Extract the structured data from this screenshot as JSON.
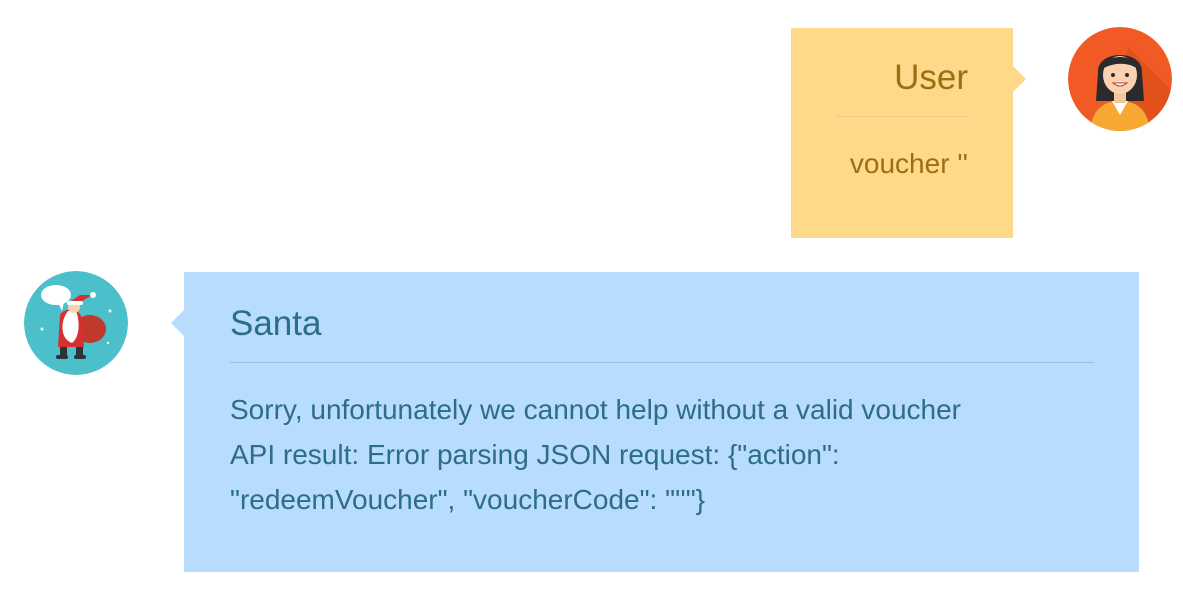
{
  "colors": {
    "user_bubble": "#ffd98a",
    "user_text": "#9c6f14",
    "santa_bubble": "#b8dcfd",
    "santa_text": "#2d6d86",
    "user_avatar_bg": "#f15a24",
    "santa_avatar_bg": "#4bbfca"
  },
  "chat": {
    "user_message": {
      "sender": "User",
      "text": "voucher ''",
      "avatar_icon": "user-woman-avatar-icon"
    },
    "santa_message": {
      "sender": "Santa",
      "lines": [
        "Sorry, unfortunately we cannot help without a valid voucher",
        "API result: Error parsing JSON request: {\"action\":",
        "\"redeemVoucher\", \"voucherCode\": \"''\"}"
      ],
      "avatar_icon": "santa-avatar-icon"
    }
  }
}
